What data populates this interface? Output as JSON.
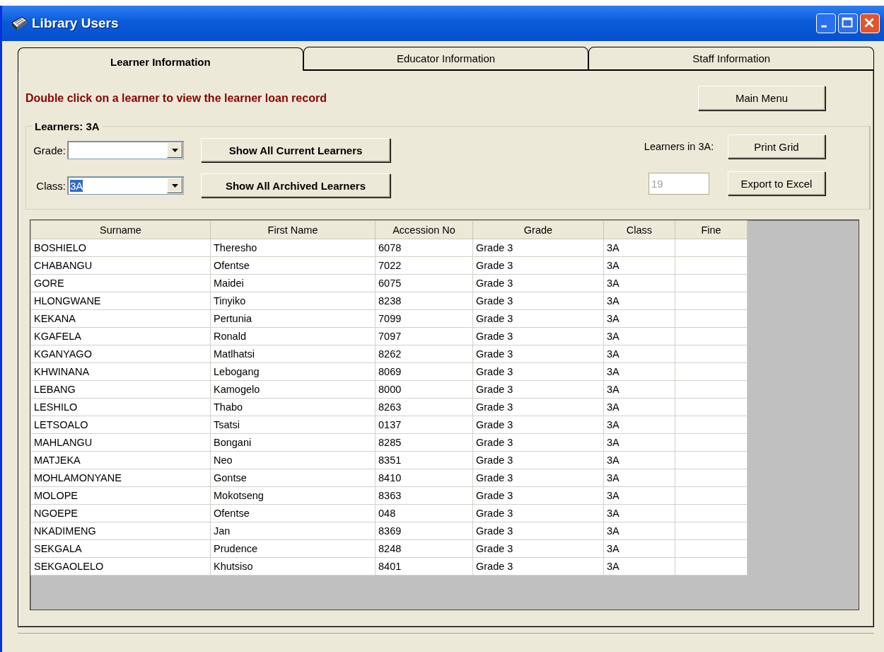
{
  "window": {
    "title": "Library Users"
  },
  "tabs": [
    {
      "label": "Learner Information",
      "selected": true
    },
    {
      "label": "Educator Information",
      "selected": false
    },
    {
      "label": "Staff Information",
      "selected": false
    }
  ],
  "instruction": "Double click on a learner to view the learner loan record",
  "main_menu_button": "Main Menu",
  "filter_group": {
    "title": "Learners: 3A",
    "grade": {
      "label": "Grade:"
    },
    "class": {
      "label": "Class:",
      "value": "3A",
      "selected": true
    },
    "buttons": [
      "Show All Current Learners",
      "Show All Archived Learners"
    ],
    "count_label": "Learners in 3A:",
    "count_field": {
      "value": "19",
      "disabled": true
    },
    "side_buttons": [
      "Print Grid",
      "Export to Excel"
    ]
  },
  "table": {
    "columns": [
      "Surname",
      "First Name",
      "Accession No",
      "Grade",
      "Class",
      "Fine"
    ],
    "rows": [
      [
        "BOSHIELO",
        "Theresho",
        "6078",
        "Grade 3",
        "3A"
      ],
      [
        "CHABANGU",
        "Ofentse",
        "7022",
        "Grade 3",
        "3A"
      ],
      [
        "GORE",
        "Maidei",
        "6075",
        "Grade 3",
        "3A"
      ],
      [
        "HLONGWANE",
        "Tinyiko",
        "8238",
        "Grade 3",
        "3A"
      ],
      [
        "KEKANA",
        "Pertunia",
        "7099",
        "Grade 3",
        "3A"
      ],
      [
        "KGAFELA",
        "Ronald",
        "7097",
        "Grade 3",
        "3A"
      ],
      [
        "KGANYAGO",
        "Matlhatsi",
        "8262",
        "Grade 3",
        "3A"
      ],
      [
        "KHWINANA",
        "Lebogang",
        "8069",
        "Grade 3",
        "3A"
      ],
      [
        "LEBANG",
        "Kamogelo",
        "8000",
        "Grade 3",
        "3A"
      ],
      [
        "LESHILO",
        "Thabo",
        "8263",
        "Grade 3",
        "3A"
      ],
      [
        "LETSOALO",
        "Tsatsi",
        "0137",
        "Grade 3",
        "3A"
      ],
      [
        "MAHLANGU",
        "Bongani",
        "8285",
        "Grade 3",
        "3A"
      ],
      [
        "MATJEKA",
        "Neo",
        "8351",
        "Grade 3",
        "3A"
      ],
      [
        "MOHLAMONYANE",
        "Gontse",
        "8410",
        "Grade 3",
        "3A"
      ],
      [
        "MOLOPE",
        "Mokotseng",
        "8363",
        "Grade 3",
        "3A"
      ],
      [
        "NGOEPE",
        "Ofentse",
        "048",
        "Grade 3",
        "3A"
      ],
      [
        "NKADIMENG",
        "Jan",
        "8369",
        "Grade 3",
        "3A"
      ],
      [
        "SEKGALA",
        "Prudence",
        "8248",
        "Grade 3",
        "3A"
      ],
      [
        "SEKGAOLELO",
        "Khutsiso",
        "8401",
        "Grade 3",
        "3A"
      ]
    ]
  }
}
